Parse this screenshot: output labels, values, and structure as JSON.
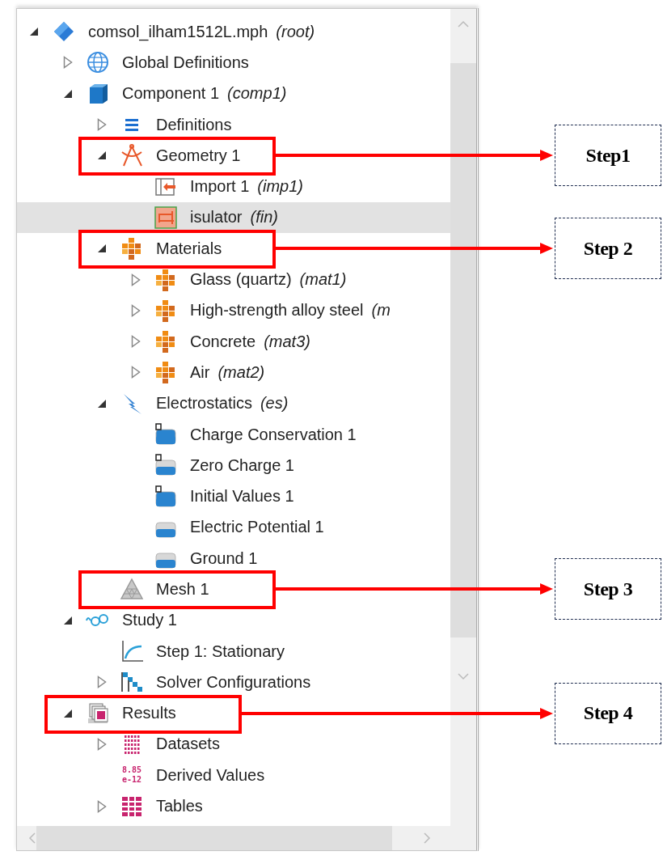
{
  "tree": {
    "label": "comsol_ilham1512L.mph",
    "tag": "(root)",
    "kind": "file",
    "expanded": true,
    "selected": false,
    "children": [
      {
        "label": "Global Definitions",
        "kind": "globe",
        "expanded": false,
        "selected": false
      },
      {
        "label": "Component 1",
        "tag": "(comp1)",
        "kind": "cube",
        "expanded": true,
        "selected": false,
        "children": [
          {
            "label": "Definitions",
            "kind": "list",
            "expanded": false,
            "selected": false
          },
          {
            "label": "Geometry 1",
            "kind": "geometry",
            "expanded": true,
            "selected": false,
            "callout": "Step1",
            "children": [
              {
                "label": "Import 1",
                "tag": "(imp1)",
                "kind": "import",
                "selected": false
              },
              {
                "label": "isulator",
                "tag": "(fin)",
                "kind": "union",
                "selected": true
              }
            ]
          },
          {
            "label": "Materials",
            "kind": "material",
            "expanded": true,
            "selected": false,
            "callout": "Step 2",
            "children": [
              {
                "label": "Glass (quartz)",
                "tag": "(mat1)",
                "kind": "material",
                "expanded": false,
                "selected": false
              },
              {
                "label": "High-strength alloy steel",
                "tag": "(m",
                "kind": "material",
                "expanded": false,
                "selected": false
              },
              {
                "label": "Concrete",
                "tag": "(mat3)",
                "kind": "material",
                "expanded": false,
                "selected": false
              },
              {
                "label": "Air",
                "tag": "(mat2)",
                "kind": "material",
                "expanded": false,
                "selected": false
              }
            ]
          },
          {
            "label": "Electrostatics",
            "tag": "(es)",
            "kind": "physics",
            "expanded": true,
            "selected": false,
            "children": [
              {
                "label": "Charge Conservation 1",
                "kind": "domain",
                "selected": false
              },
              {
                "label": "Zero Charge 1",
                "kind": "domain-boundary",
                "selected": false
              },
              {
                "label": "Initial Values 1",
                "kind": "domain",
                "selected": false
              },
              {
                "label": "Electric Potential 1",
                "kind": "boundary",
                "selected": false
              },
              {
                "label": "Ground 1",
                "kind": "boundary",
                "selected": false
              }
            ]
          },
          {
            "label": "Mesh 1",
            "kind": "mesh",
            "selected": false,
            "callout": "Step 3"
          }
        ]
      },
      {
        "label": "Study 1",
        "kind": "study",
        "expanded": true,
        "selected": false,
        "children": [
          {
            "label": "Step 1: Stationary",
            "kind": "step",
            "selected": false
          },
          {
            "label": "Solver Configurations",
            "kind": "solver",
            "expanded": false,
            "selected": false
          }
        ]
      },
      {
        "label": "Results",
        "kind": "results",
        "expanded": true,
        "selected": false,
        "callout": "Step 4",
        "children": [
          {
            "label": "Datasets",
            "kind": "datasets",
            "expanded": false,
            "selected": false
          },
          {
            "label": "Derived Values",
            "kind": "derived",
            "icon_text": [
              "8.85",
              "e-12"
            ],
            "selected": false
          },
          {
            "label": "Tables",
            "kind": "tables",
            "expanded": false,
            "selected": false
          }
        ]
      }
    ]
  }
}
